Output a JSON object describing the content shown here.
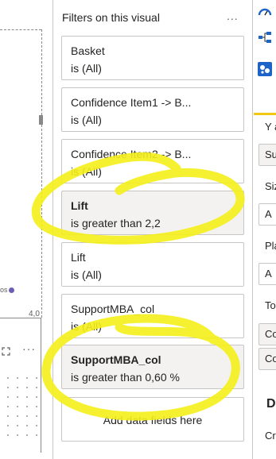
{
  "canvas": {
    "legend_fragment": "os",
    "axis_value": "4,0",
    "more_label": "···"
  },
  "filter_pane": {
    "title": "Filters on this visual",
    "more_label": "...",
    "cards": [
      {
        "name": "Basket",
        "condition": "is (All)",
        "active": false
      },
      {
        "name": "Confidence Item1 -> B...",
        "condition": "is (All)",
        "active": false
      },
      {
        "name": "Confidence Item2 -> B...",
        "condition": "is (All)",
        "active": false
      },
      {
        "name": "Lift",
        "condition": "is greater than 2,2",
        "active": true
      },
      {
        "name": "Lift",
        "condition": "is (All)",
        "active": false
      },
      {
        "name": "SupportMBA_col",
        "condition": "is (All)",
        "active": false
      },
      {
        "name": "SupportMBA_col",
        "condition": "is greater than 0,60 %",
        "active": true
      }
    ],
    "add_fields_label": "Add data fields here"
  },
  "viz_pane": {
    "labels": [
      "Y a",
      "Siz",
      "Pla",
      "To",
      "Cro"
    ],
    "fields": [
      "Su",
      "A",
      "A",
      "Co",
      "Co"
    ],
    "section_heading": "D"
  },
  "colors": {
    "accent_yellow": "#f2c811",
    "marker_yellow": "#f5f01a",
    "legend_dot": "#6b5fb5"
  }
}
